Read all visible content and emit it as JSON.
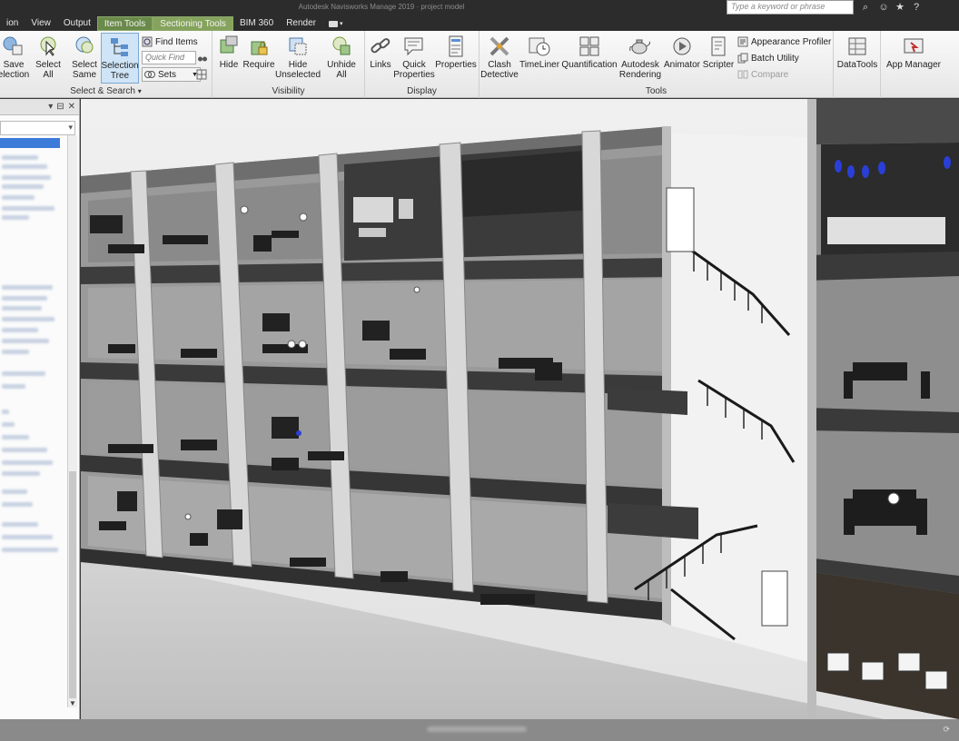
{
  "tabs": [
    "ion",
    "View",
    "Output",
    "Item Tools",
    "Sectioning Tools",
    "BIM 360",
    "Render"
  ],
  "search_placeholder": "Type a keyword or phrase",
  "ribbon": {
    "select_search": {
      "title": "Select & Search",
      "save_selection": "Save\nelection",
      "select_all": "Select\nAll",
      "select_same": "Select\nSame",
      "selection_tree": "Selection\nTree",
      "find_items": "Find Items",
      "quick_find": "Quick Find",
      "sets": "Sets"
    },
    "visibility": {
      "title": "Visibility",
      "hide": "Hide",
      "require": "Require",
      "hide_unselected": "Hide\nUnselected",
      "unhide_all": "Unhide\nAll"
    },
    "display": {
      "title": "Display",
      "links": "Links",
      "quick_properties": "Quick\nProperties",
      "properties": "Properties"
    },
    "tools": {
      "title": "Tools",
      "clash_detective": "Clash\nDetective",
      "timeliner": "TimeLiner",
      "quantification": "Quantification",
      "autodesk_rendering": "Autodesk\nRendering",
      "animator": "Animator",
      "scripter": "Scripter",
      "appearance_profiler": "Appearance Profiler",
      "batch_utility": "Batch Utility",
      "compare": "Compare"
    },
    "datatools": "DataTools",
    "app_manager": "App Manager"
  },
  "colors": {
    "selection_blue": "#3d7bd9",
    "context_tab_green": "#6a8a4a",
    "light_fixture_blue": "#2a3fd8"
  }
}
